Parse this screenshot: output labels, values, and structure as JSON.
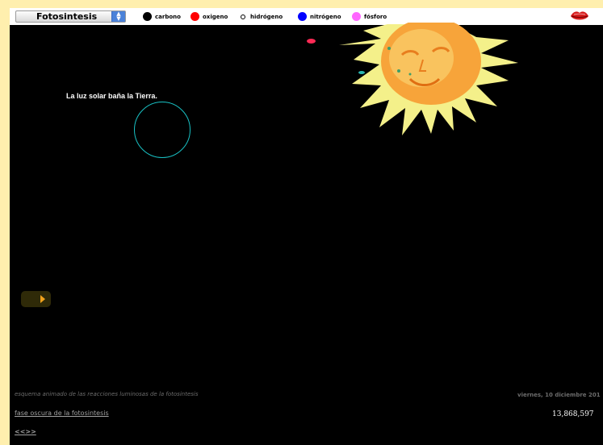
{
  "selector": {
    "value": "Fotosintesis"
  },
  "legend": [
    {
      "label": "carbono",
      "color": "#000000",
      "icon": "carbon-dot"
    },
    {
      "label": "oxigeno",
      "color": "#ff0000",
      "icon": "oxygen-dot"
    },
    {
      "label": "hidrógeno",
      "color": "#ffffff",
      "icon": "hydrogen-dot"
    },
    {
      "label": "nitrógeno",
      "color": "#0000ff",
      "icon": "nitrogen-dot"
    },
    {
      "label": "fósforo",
      "color": "#ff66ff",
      "icon": "phosphorus-dot"
    }
  ],
  "scene": {
    "caption": "La luz solar baña la Tierra."
  },
  "footer": {
    "description": "esquema animado de las reacciones luminosas de la fotosintesis",
    "date": "viernes, 10 diciembre 201",
    "link": "fase oscura de la fotosintesis",
    "counter": "13,868,597",
    "nav": "<<>>"
  },
  "colors": {
    "page_background": "#ffefae",
    "stage_background": "#000000",
    "earth_outline": "#19c1c4",
    "sun_rays": "#f4f08a",
    "sun_face": "#f7a43a",
    "play_icon": "#f0a11c"
  }
}
